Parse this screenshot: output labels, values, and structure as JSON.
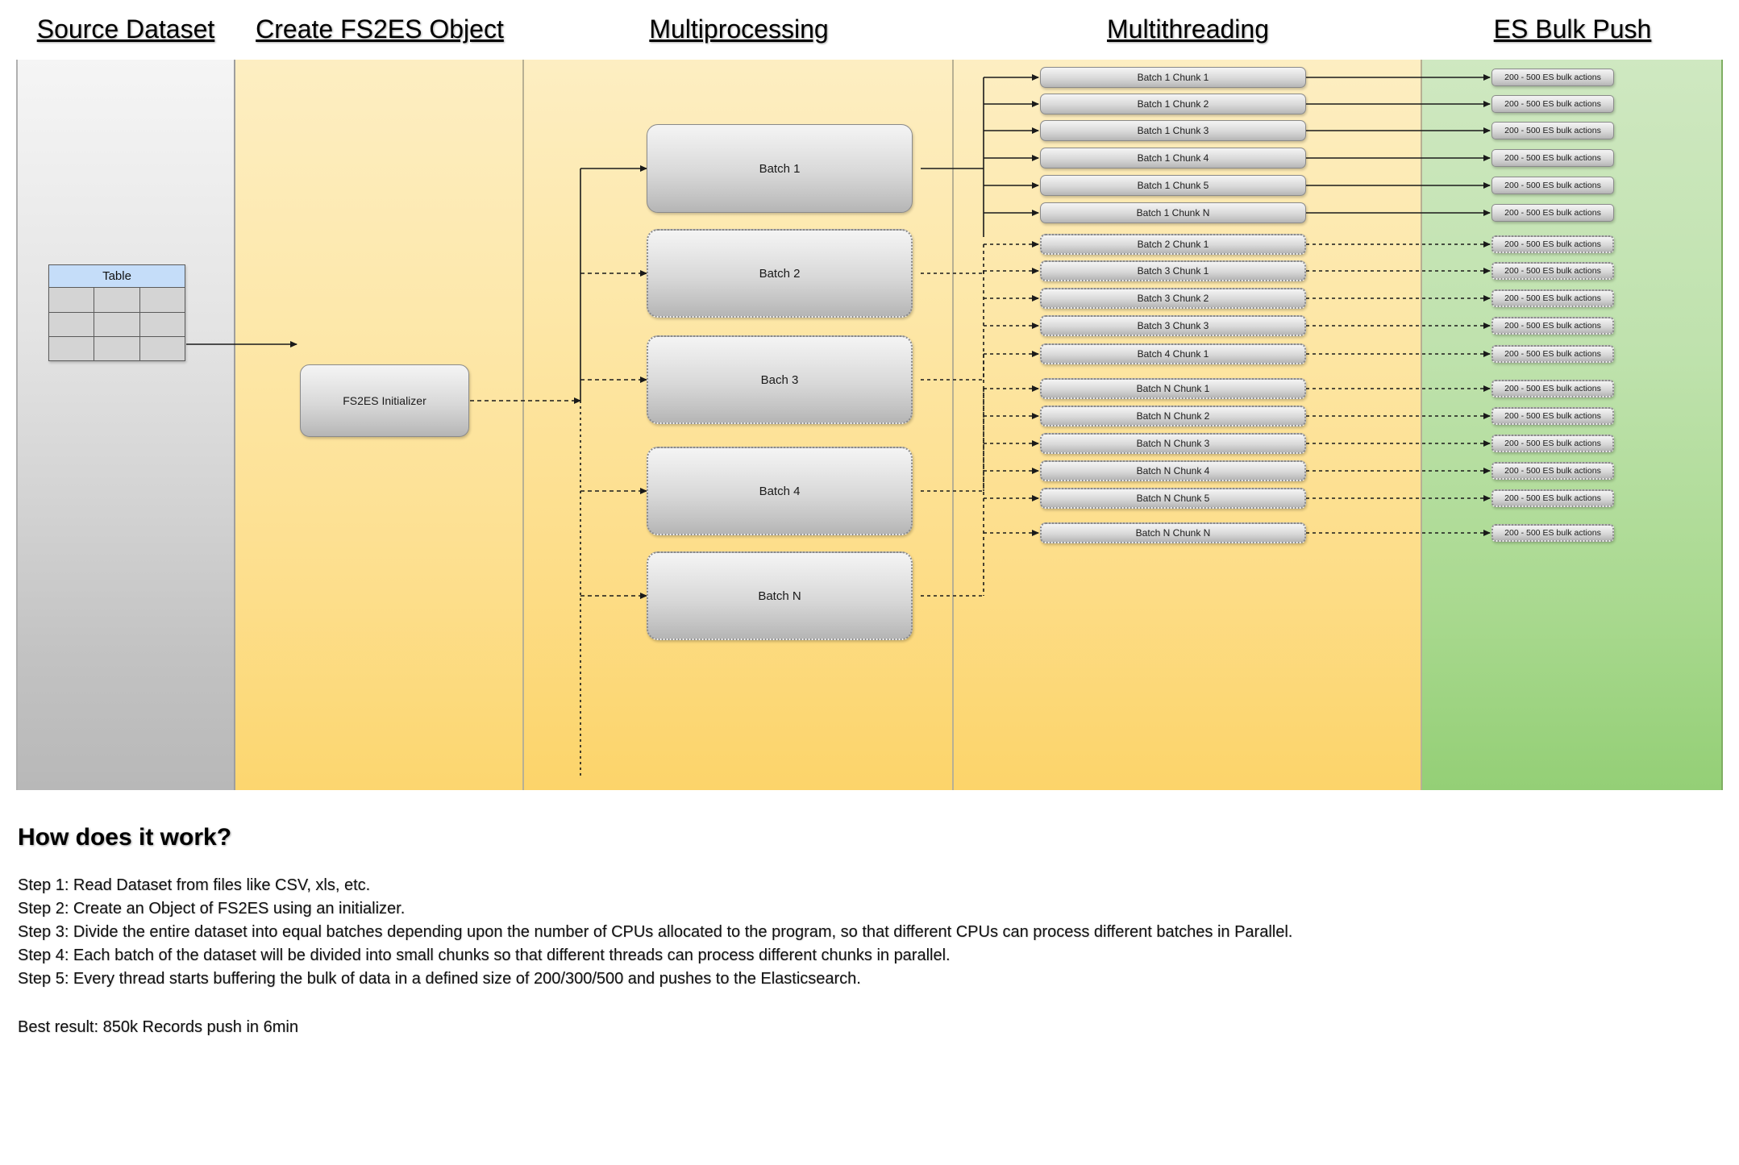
{
  "lanes": [
    {
      "id": "source",
      "title": "Source Dataset"
    },
    {
      "id": "create",
      "title": "Create FS2ES Object"
    },
    {
      "id": "mproc",
      "title": "Multiprocessing"
    },
    {
      "id": "mthread",
      "title": "Multithreading"
    },
    {
      "id": "esbulk",
      "title": "ES Bulk Push"
    }
  ],
  "source": {
    "table_header": "Table",
    "rows": 3,
    "cols": 3
  },
  "create": {
    "initializer_label": "FS2ES Initializer"
  },
  "batches": [
    {
      "label": "Batch 1",
      "style": "solid"
    },
    {
      "label": "Batch 2",
      "style": "dotted"
    },
    {
      "label": "Bach 3",
      "style": "dotted"
    },
    {
      "label": "Batch 4",
      "style": "dotted"
    },
    {
      "label": "Batch N",
      "style": "dotted"
    }
  ],
  "chunks": [
    {
      "label": "Batch 1 Chunk 1",
      "style": "solid"
    },
    {
      "label": "Batch 1 Chunk 2",
      "style": "solid"
    },
    {
      "label": "Batch 1 Chunk 3",
      "style": "solid"
    },
    {
      "label": "Batch 1 Chunk 4",
      "style": "solid"
    },
    {
      "label": "Batch 1 Chunk 5",
      "style": "solid"
    },
    {
      "label": "Batch 1 Chunk N",
      "style": "solid"
    },
    {
      "label": "Batch 2 Chunk 1",
      "style": "dotted"
    },
    {
      "label": "Batch 3 Chunk 1",
      "style": "dotted"
    },
    {
      "label": "Batch 3 Chunk 2",
      "style": "dotted"
    },
    {
      "label": "Batch 3 Chunk 3",
      "style": "dotted"
    },
    {
      "label": "Batch 4 Chunk 1",
      "style": "dotted"
    },
    {
      "label": "Batch N Chunk 1",
      "style": "dotted"
    },
    {
      "label": "Batch N Chunk 2",
      "style": "dotted"
    },
    {
      "label": "Batch N Chunk 3",
      "style": "dotted"
    },
    {
      "label": "Batch N Chunk 4",
      "style": "dotted"
    },
    {
      "label": "Batch N Chunk 5",
      "style": "dotted"
    },
    {
      "label": "Batch N Chunk N",
      "style": "dotted"
    }
  ],
  "bulk_actions": [
    {
      "label": "200 - 500 ES bulk actions",
      "style": "solid"
    },
    {
      "label": "200 - 500 ES bulk actions",
      "style": "solid"
    },
    {
      "label": "200 - 500 ES bulk actions",
      "style": "solid"
    },
    {
      "label": "200 - 500 ES bulk actions",
      "style": "solid"
    },
    {
      "label": "200 - 500 ES bulk actions",
      "style": "solid"
    },
    {
      "label": "200 - 500 ES bulk actions",
      "style": "solid"
    },
    {
      "label": "200 - 500 ES bulk actions",
      "style": "dotted"
    },
    {
      "label": "200 - 500 ES bulk actions",
      "style": "dotted"
    },
    {
      "label": "200 - 500 ES bulk actions",
      "style": "dotted"
    },
    {
      "label": "200 - 500 ES bulk actions",
      "style": "dotted"
    },
    {
      "label": "200 - 500 ES bulk actions",
      "style": "dotted"
    },
    {
      "label": "200 - 500 ES bulk actions",
      "style": "dotted"
    },
    {
      "label": "200 - 500 ES bulk actions",
      "style": "dotted"
    },
    {
      "label": "200 - 500 ES bulk actions",
      "style": "dotted"
    },
    {
      "label": "200 - 500 ES bulk actions",
      "style": "dotted"
    },
    {
      "label": "200 - 500 ES bulk actions",
      "style": "dotted"
    },
    {
      "label": "200 - 500 ES bulk actions",
      "style": "dotted"
    }
  ],
  "prose": {
    "heading": "How does it work?",
    "steps": [
      "Step 1: Read Dataset from files like CSV, xls, etc.",
      "Step 2: Create an Object of FS2ES using an initializer.",
      "Step 3: Divide the entire dataset into equal batches depending upon the number of CPUs allocated to the program, so that different CPUs can process different batches in Parallel.",
      "Step 4: Each batch of the dataset will be divided into small chunks so that different threads can process different chunks in parallel.",
      "Step 5: Every thread starts buffering the bulk of data in a defined size of 200/300/500 and pushes to the Elasticsearch."
    ],
    "best_result": "Best result: 850k Records push in 6min"
  },
  "colors": {
    "source_lane": "#d2d2d2",
    "process_lane": "#fcd46a",
    "es_lane": "#a9d98f",
    "table_header": "#c5ddf9",
    "node_fill": "#d8d8d8",
    "connector": "#222222"
  }
}
